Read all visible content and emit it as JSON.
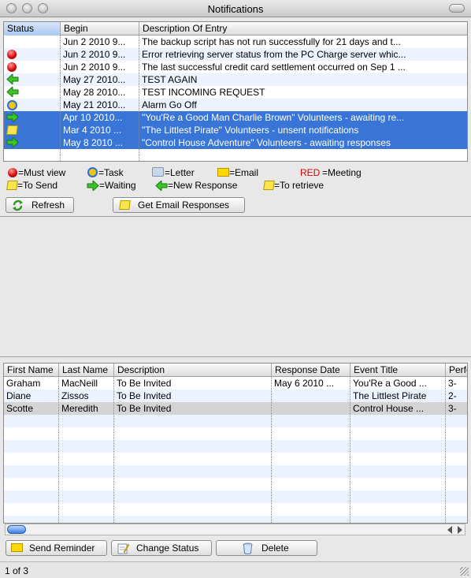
{
  "window": {
    "title": "Notifications"
  },
  "notifications": {
    "columns": [
      "Status",
      "Begin",
      "Description Of Entry"
    ],
    "rows": [
      {
        "status_icon": "none",
        "begin": "Jun 2 2010 9...",
        "description": "The backup script has not run successfully for 21 days and t...",
        "state": "normal"
      },
      {
        "status_icon": "red-circle-icon",
        "begin": "Jun 2 2010 9...",
        "description": "Error retrieving server status from the PC Charge server whic...",
        "state": "alt"
      },
      {
        "status_icon": "red-circle-icon",
        "begin": "Jun 2 2010 9...",
        "description": "The last successful credit card settlement occurred on Sep 1 ...",
        "state": "normal"
      },
      {
        "status_icon": "green-left-arrow-icon",
        "begin": "May 27 2010...",
        "description": "TEST AGAIN",
        "state": "alt"
      },
      {
        "status_icon": "green-left-arrow-icon",
        "begin": "May 28 2010...",
        "description": "TEST INCOMING REQUEST",
        "state": "normal"
      },
      {
        "status_icon": "clock-task-icon",
        "begin": "May 21 2010...",
        "description": "Alarm Go Off",
        "state": "alt"
      },
      {
        "status_icon": "green-right-arrow-icon",
        "begin": "Apr 10 2010...",
        "description": "\"You'Re a Good Man Charlie Brown\" Volunteers - awaiting re...",
        "state": "selected"
      },
      {
        "status_icon": "yellow-note-icon",
        "begin": "Mar 4 2010 ...",
        "description": "\"The Littlest Pirate\" Volunteers - unsent notifications",
        "state": "selected"
      },
      {
        "status_icon": "green-right-arrow-icon",
        "begin": "May 8 2010 ...",
        "description": "\"Control House Adventure\" Volunteers - awaiting responses",
        "state": "selected"
      }
    ]
  },
  "legend": {
    "must_view": "=Must view",
    "task": "=Task",
    "letter": "=Letter",
    "email": "=Email",
    "red_word": "RED",
    "meeting": "=Meeting",
    "to_send": "=To Send",
    "waiting": "=Waiting",
    "new_response": "=New Response",
    "to_retrieve": "=To retrieve"
  },
  "top_buttons": {
    "refresh": "Refresh",
    "get_email": "Get Email Responses"
  },
  "volunteers": {
    "columns": [
      "First Name",
      "Last Name",
      "Description",
      "Response Date",
      "Event Title",
      "Perfo"
    ],
    "rows": [
      {
        "first": "Graham",
        "last": "MacNeill",
        "description": "To Be Invited",
        "response_date": "May 6 2010 ...",
        "event": "You'Re a Good ...",
        "perf": "3-"
      },
      {
        "first": "Diane",
        "last": "Zissos",
        "description": "To Be Invited",
        "response_date": "",
        "event": "The Littlest Pirate",
        "perf": "2-"
      },
      {
        "first": "Scotte",
        "last": "Meredith",
        "description": "To Be Invited",
        "response_date": "",
        "event": "Control House ...",
        "perf": "3-"
      }
    ]
  },
  "bottom_buttons": {
    "send_reminder": "Send Reminder",
    "change_status": "Change Status",
    "delete": "Delete"
  },
  "status": {
    "text": "1 of 3"
  },
  "colors": {
    "selection": "#3875d7",
    "alt_row": "#edf3fe",
    "meeting_red": "#e00000"
  }
}
